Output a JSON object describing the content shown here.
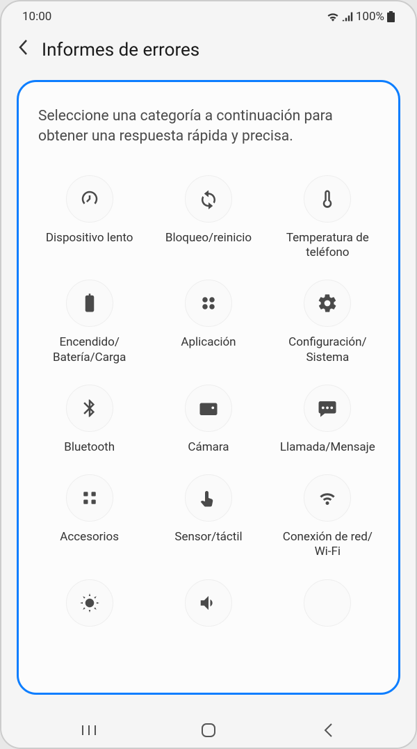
{
  "statusBar": {
    "time": "10:00",
    "battery": "100%"
  },
  "header": {
    "title": "Informes de errores"
  },
  "instruction": "Seleccione una categoría a continuación para obtener una respuesta rápida y precisa.",
  "categories": [
    {
      "label": "Dispositivo lento",
      "icon": "speedometer"
    },
    {
      "label": "Bloqueo/reinicio",
      "icon": "restart"
    },
    {
      "label": "Temperatura de teléfono",
      "icon": "thermometer"
    },
    {
      "label": "Encendido/\nBatería/Carga",
      "icon": "battery"
    },
    {
      "label": "Aplicación",
      "icon": "apps"
    },
    {
      "label": "Configuración/\nSistema",
      "icon": "settings"
    },
    {
      "label": "Bluetooth",
      "icon": "bluetooth"
    },
    {
      "label": "Cámara",
      "icon": "camera"
    },
    {
      "label": "Llamada/Mensaje",
      "icon": "message"
    },
    {
      "label": "Accesorios",
      "icon": "apps"
    },
    {
      "label": "Sensor/táctil",
      "icon": "touch"
    },
    {
      "label": "Conexión de red/\nWi-Fi",
      "icon": "wifi"
    }
  ]
}
